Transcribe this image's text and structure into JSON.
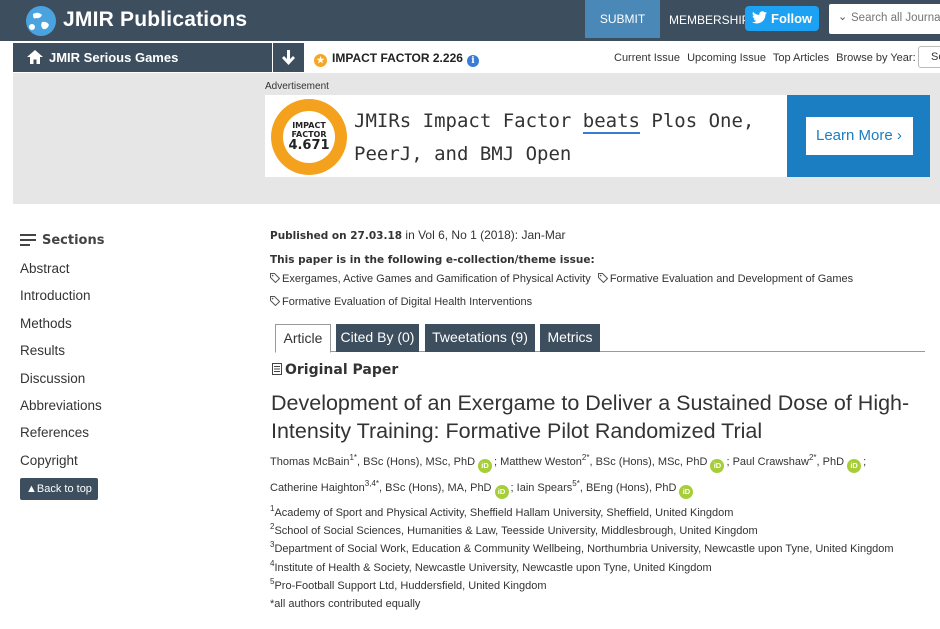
{
  "header": {
    "brand": "JMIR Publications",
    "submit": "SUBMIT",
    "membership": "MEMBERSHIP",
    "follow": "Follow",
    "search_placeholder": "Search all Journals",
    "colors": {
      "bar": "#3d4e5e",
      "submit": "#4a88b8",
      "twitter": "#1da1f2"
    }
  },
  "journal_bar": {
    "journal": "JMIR Serious Games",
    "impact": "IMPACT FACTOR 2.226",
    "links": [
      "Current Issue",
      "Upcoming Issue",
      "Top Articles",
      "Browse by Year:"
    ],
    "year_value": "Se"
  },
  "ad": {
    "label": "Advertisement",
    "badge_top": "IMPACT FACTOR",
    "badge_value": "4.671",
    "line1_pre": "JMIRs Impact Factor ",
    "line1_em": "beats",
    "line1_post": " Plos One,",
    "line2": "PeerJ, and BMJ Open",
    "cta": "Learn More"
  },
  "sidebar": {
    "heading": "Sections",
    "items": [
      "Abstract",
      "Introduction",
      "Methods",
      "Results",
      "Discussion",
      "Abbreviations",
      "References",
      "Copyright"
    ],
    "back_to_top": "Back to top"
  },
  "article": {
    "published_label": "Published on 27.03.18",
    "published_in": " in ",
    "volume": "Vol 6, No 1 (2018): Jan-Mar",
    "ecollection": "This paper is in the following e-collection/theme issue:",
    "tags": [
      "Exergames, Active Games and Gamification of Physical Activity",
      "Formative Evaluation and Development of Games",
      "Formative Evaluation of Digital Health Interventions"
    ],
    "tabs": [
      "Article",
      "Cited By (0)",
      "Tweetations (9)",
      "Metrics"
    ],
    "type": "Original Paper",
    "title": "Development of an Exergame to Deliver a Sustained Dose of High-Intensity Training: Formative Pilot Randomized Trial",
    "authors": [
      {
        "name": "Thomas McBain",
        "sup": "1*",
        "degrees": ", BSc (Hons), MSc, PhD"
      },
      {
        "name": "Matthew Weston",
        "sup": "2*",
        "degrees": ", BSc (Hons), MSc, PhD"
      },
      {
        "name": "Paul Crawshaw",
        "sup": "2*",
        "degrees": ", PhD"
      },
      {
        "name": "Catherine Haighton",
        "sup": "3,4*",
        "degrees": ", BSc (Hons), MA, PhD"
      },
      {
        "name": "Iain Spears",
        "sup": "5*",
        "degrees": ", BEng (Hons), PhD"
      }
    ],
    "orcid_label": "iD",
    "affiliations": [
      {
        "num": "1",
        "text": "Academy of Sport and Physical Activity, Sheffield Hallam University, Sheffield, United Kingdom"
      },
      {
        "num": "2",
        "text": "School of Social Sciences, Humanities & Law, Teesside University, Middlesbrough, United Kingdom"
      },
      {
        "num": "3",
        "text": "Department of Social Work, Education & Community Wellbeing, Northumbria University, Newcastle upon Tyne, United Kingdom"
      },
      {
        "num": "4",
        "text": "Institute of Health & Society, Newcastle University, Newcastle upon Tyne, United Kingdom"
      },
      {
        "num": "5",
        "text": "Pro-Football Support Ltd, Huddersfield, United Kingdom"
      }
    ],
    "note": "*all authors contributed equally"
  }
}
